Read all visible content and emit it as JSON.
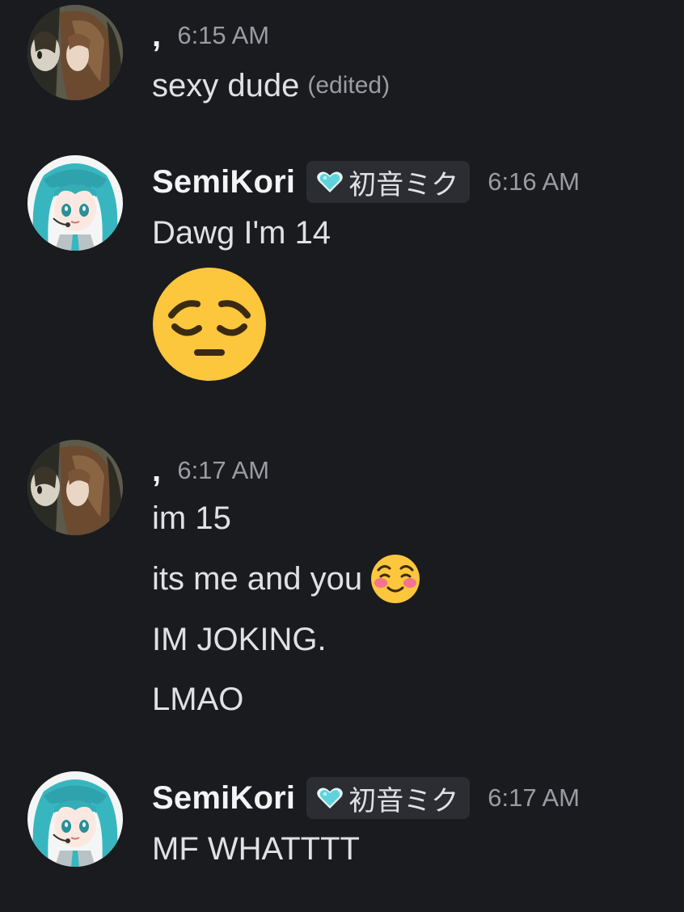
{
  "messages": [
    {
      "author": ",",
      "timestamp": "6:15 AM",
      "avatar": "brown-hair-anime-avatar",
      "lines": [
        {
          "text": "sexy dude",
          "edited": "(edited)"
        }
      ]
    },
    {
      "author": "SemiKori",
      "tag": {
        "icon": "cyan-heart-icon",
        "text": "初音ミク"
      },
      "timestamp": "6:16 AM",
      "avatar": "miku-avatar",
      "lines": [
        {
          "text": "Dawg I'm 14"
        }
      ],
      "emoji": "pensive-face-emoji"
    },
    {
      "author": ",",
      "timestamp": "6:17 AM",
      "avatar": "brown-hair-anime-avatar",
      "lines": [
        {
          "text": "im 15"
        },
        {
          "text": "its me and you",
          "emoji": "smiling-face-emoji"
        },
        {
          "text": "IM JOKING."
        },
        {
          "text": "LMAO"
        }
      ]
    },
    {
      "author": "SemiKori",
      "tag": {
        "icon": "cyan-heart-icon",
        "text": "初音ミク"
      },
      "timestamp": "6:17 AM",
      "avatar": "miku-avatar",
      "lines": [
        {
          "text": "MF WHATTTT"
        }
      ]
    }
  ],
  "colors": {
    "background": "#1a1b1f",
    "text": "#dfe1e5",
    "muted": "#9a9ca3",
    "tag_background": "#2b2d33",
    "heart": "#5fd3dc"
  }
}
